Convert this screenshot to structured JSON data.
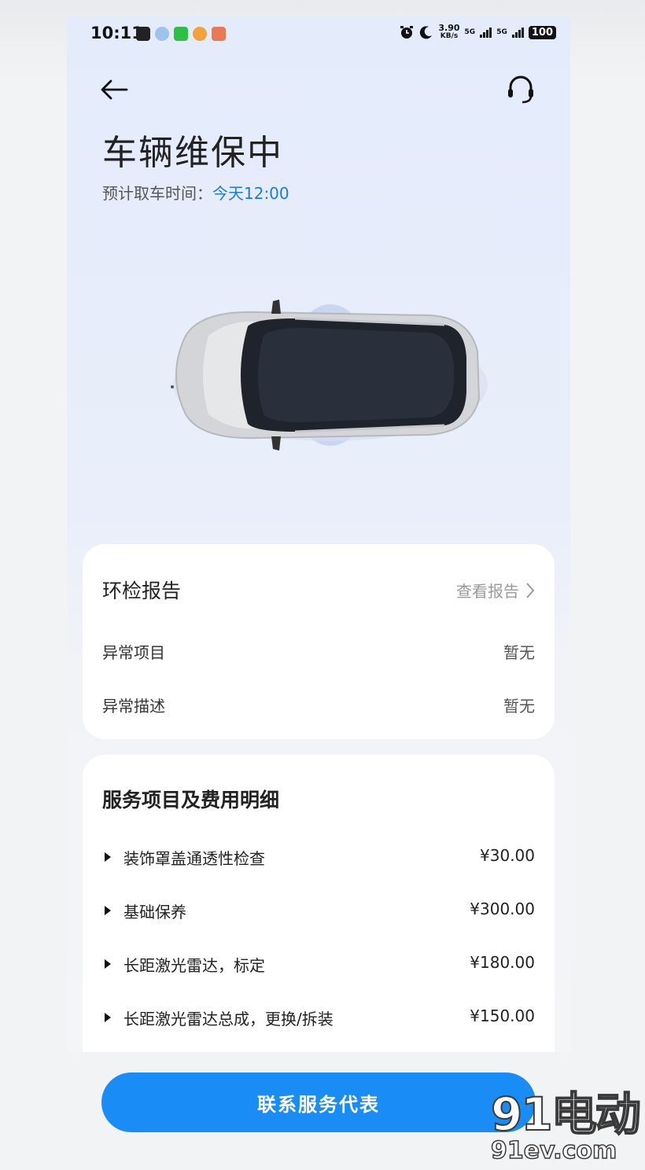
{
  "statusbar": {
    "time": "10:11",
    "speed_value": "3.90",
    "speed_unit": "KB/s",
    "net1": "5G",
    "net2": "5G",
    "battery": "100"
  },
  "icons": {
    "back": "arrow-left-icon",
    "support": "headset-icon",
    "chevron": "chevron-right-icon",
    "expand": "triangle-right-icon"
  },
  "header": {
    "title": "车辆维保中",
    "pickup_label": "预计取车时间：",
    "pickup_time": "今天12:00"
  },
  "inspection": {
    "title": "环检报告",
    "link_label": "查看报告",
    "rows": [
      {
        "label": "异常项目",
        "value": "暂无"
      },
      {
        "label": "异常描述",
        "value": "暂无"
      }
    ]
  },
  "services": {
    "title": "服务项目及费用明细",
    "items": [
      {
        "name": "装饰罩盖通透性检查",
        "price": "¥30.00"
      },
      {
        "name": "基础保养",
        "price": "¥300.00"
      },
      {
        "name": "长距激光雷达，标定",
        "price": "¥180.00"
      },
      {
        "name": "长距激光雷达总成，更换/拆装",
        "price": "¥150.00"
      }
    ]
  },
  "cta": {
    "label": "联系服务代表"
  },
  "watermark": {
    "top": "91电动",
    "bottom": "91ev.com"
  },
  "colors": {
    "accent": "#1a8cf5",
    "pickup_time": "#1e7bd9",
    "page_bg": "#e4ebfb",
    "card_bg": "#ffffff"
  }
}
